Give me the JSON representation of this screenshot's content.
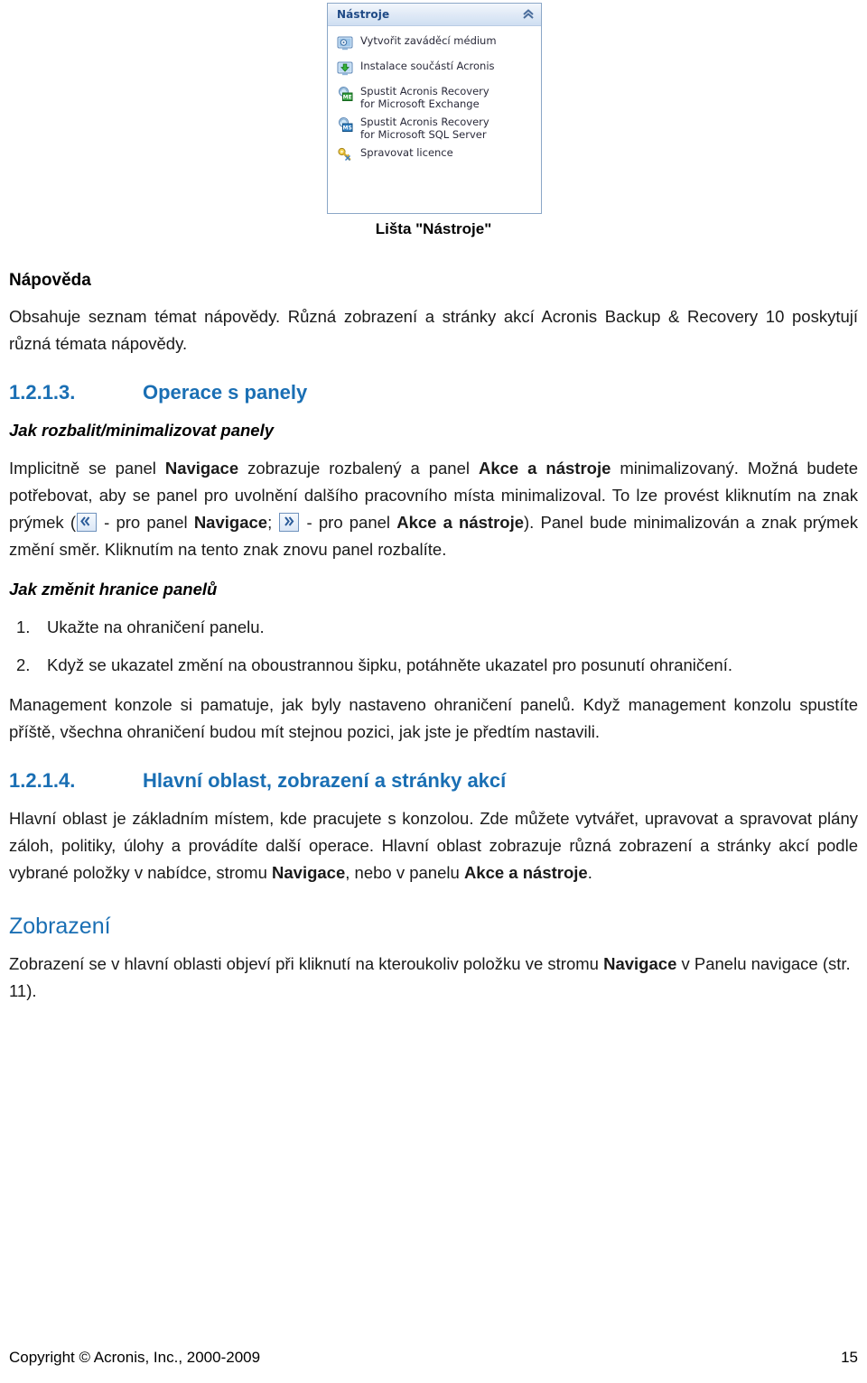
{
  "figure": {
    "panel": {
      "title": "Nástroje",
      "collapse_icon": "chevron-up-icon",
      "items": [
        {
          "icon": "bootable-media-icon",
          "label": "Vytvořit zaváděcí médium"
        },
        {
          "icon": "install-components-icon",
          "label": "Instalace součástí Acronis"
        },
        {
          "icon": "exchange-recovery-icon",
          "label": "Spustit Acronis Recovery\nfor Microsoft Exchange"
        },
        {
          "icon": "sql-recovery-icon",
          "label": "Spustit Acronis Recovery\nfor Microsoft SQL Server"
        },
        {
          "icon": "license-key-icon",
          "label": "Spravovat licence"
        }
      ]
    },
    "caption": "Lišta \"Nástroje\""
  },
  "sections": {
    "napoveda": {
      "heading": "Nápověda",
      "paragraph": "Obsahuje seznam témat nápovědy. Různá zobrazení a stránky akcí Acronis Backup & Recovery 10 poskytují různá témata nápovědy."
    },
    "operace": {
      "number": "1.2.1.3.",
      "title": "Operace s panely",
      "sub1_heading": "Jak rozbalit/minimalizovat panely",
      "para1_a": "Implicitně se panel ",
      "para1_b1": "Navigace",
      "para1_c": " zobrazuje rozbalený a panel ",
      "para1_b2": "Akce a nástroje",
      "para1_d": " minimalizovaný. Možná budete potřebovat, aby se panel pro uvolnění dalšího pracovního místa minimalizoval. To lze provést kliknutím na znak prýmek (",
      "para1_e": " - pro panel ",
      "para1_b3": "Navigace",
      "para1_f": "; ",
      "para1_g": " - pro panel ",
      "para1_b4": "Akce a nástroje",
      "para1_h": "). Panel bude minimalizován a znak prýmek změní směr. Kliknutím na tento znak znovu panel rozbalíte.",
      "icon_left": "double-chevron-left-icon",
      "icon_right": "double-chevron-right-icon",
      "sub2_heading": "Jak změnit hranice panelů",
      "steps": [
        {
          "num": "1.",
          "text": "Ukažte na ohraničení panelu."
        },
        {
          "num": "2.",
          "text": "Když se ukazatel změní na oboustrannou šipku, potáhněte ukazatel pro posunutí ohraničení."
        }
      ],
      "para2": "Management konzole si pamatuje, jak byly nastaveno ohraničení panelů. Když management konzolu spustíte příště, všechna ohraničení budou mít stejnou pozici, jak jste je předtím nastavili."
    },
    "hlavni_oblast": {
      "number": "1.2.1.4.",
      "title": "Hlavní oblast, zobrazení a stránky akcí",
      "para_a": "Hlavní oblast je základním místem, kde pracujete s konzolou. Zde můžete vytvářet, upravovat a spravovat plány záloh, politiky, úlohy a provádíte další operace. Hlavní oblast zobrazuje různá zobrazení a stránky akcí podle vybrané položky v nabídce, stromu ",
      "para_b1": "Navigace",
      "para_c": ", nebo v panelu ",
      "para_b2": "Akce a nástroje",
      "para_d": "."
    },
    "zobrazeni": {
      "heading": "Zobrazení",
      "para_a": "Zobrazení se v hlavní oblasti objeví při kliknutí na kteroukoliv položku ve stromu ",
      "para_b": "Navigace",
      "para_c": " v Panelu navigace (str.  11)."
    }
  },
  "footer": {
    "copyright": "Copyright © Acronis, Inc., 2000-2009",
    "page_number": "15"
  },
  "colors": {
    "heading_blue": "#1a6fb4",
    "panel_title_blue": "#1f4a86",
    "panel_border": "#8ba7c7"
  }
}
